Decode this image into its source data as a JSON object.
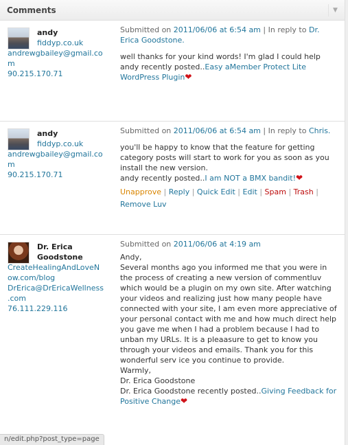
{
  "widget": {
    "title": "Comments",
    "toggle_icon": "triangle-down-icon"
  },
  "comments": [
    {
      "author": "andy",
      "site": "fiddyp.co.uk",
      "email_line1": "andrewgbailey@gmail.co",
      "email_line2": "m",
      "ip": "90.215.170.71",
      "submitted_prefix": "Submitted on",
      "date": "2011/06/06 at 6:54 am",
      "reply_prefix": "| In reply to",
      "reply_to": "Dr. Erica Goodstone.",
      "body": "well thanks for your kind words! I'm glad I could help",
      "luv_prefix": "andy recently posted..",
      "luv_link": "Easy aMember Protect Lite WordPress Plugin"
    },
    {
      "author": "andy",
      "site": "fiddyp.co.uk",
      "email_line1": "andrewgbailey@gmail.co",
      "email_line2": "m",
      "ip": "90.215.170.71",
      "submitted_prefix": "Submitted on",
      "date": "2011/06/06 at 6:54 am",
      "reply_prefix": "| In reply to",
      "reply_to": "Chris.",
      "body": "you'll be happy to know that the feature for getting category posts will start to work for you as soon as you install the new version.",
      "luv_prefix": "andy recently posted..",
      "luv_link": "I am NOT a BMX bandit!",
      "actions": {
        "unapprove": "Unapprove",
        "reply": "Reply",
        "quick_edit": "Quick Edit",
        "edit": "Edit",
        "spam": "Spam",
        "trash": "Trash",
        "remove_luv": "Remove Luv"
      }
    },
    {
      "author_line1": "Dr. Erica",
      "author_line2": "Goodstone",
      "site_line1": "CreateHealingAndLoveN",
      "site_line2": "ow.com/blog",
      "email_line1": "DrErica@DrEricaWellness",
      "email_line2": ".com",
      "ip": "76.111.229.116",
      "submitted_prefix": "Submitted on",
      "date": "2011/06/06 at 4:19 am",
      "greeting": "Andy,",
      "body": "Several months ago you informed me that you were in the process of creating a new version of commentluv which would be a plugin on my own site. After watching your videos and realizing just how many people have connected with your site, I am even more appreciative of your personal contact with me and how much direct help you gave me when I had a problem because I had to unban my URLs. It is a pleaasure to get to know you through your videos and emails. Thank you for this wonderful serv ice you continue to provide.",
      "closing": "Warmly,",
      "signature": "Dr. Erica Goodstone",
      "luv_prefix": "Dr. Erica Goodstone recently posted..",
      "luv_link": "Giving Feedback for Positive Change"
    }
  ],
  "status_bar": "n/edit.php?post_type=page"
}
